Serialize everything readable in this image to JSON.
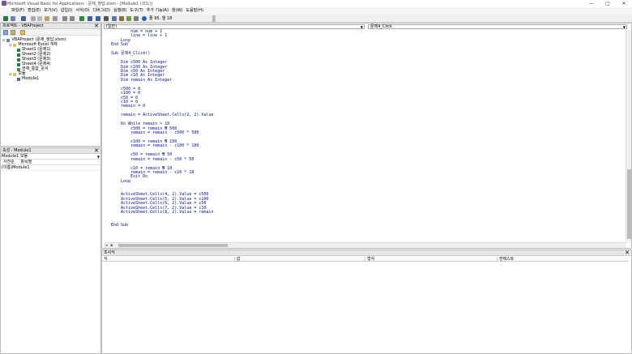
{
  "window": {
    "title": "Microsoft Visual Basic for Applications - 문제_정답.xlsm - [Module1 (코드)]",
    "min": "—",
    "max": "□",
    "close": "✕"
  },
  "menu": [
    "파일(F)",
    "편집(E)",
    "보기(V)",
    "삽입(I)",
    "서식(O)",
    "디버그(D)",
    "실행(R)",
    "도구(T)",
    "추가 기능(A)",
    "창(W)",
    "도움말(H)"
  ],
  "toolbar": {
    "position": "줄 95, 열 18",
    "icons": [
      "excel-icon",
      "insert-module-icon",
      "save-icon",
      "cut-icon",
      "copy-icon",
      "paste-icon",
      "find-icon",
      "undo-icon",
      "redo-icon",
      "run-icon",
      "break-icon",
      "reset-icon",
      "design-mode-icon",
      "project-explorer-icon",
      "properties-icon",
      "object-browser-icon",
      "toolbox-icon",
      "help-icon"
    ]
  },
  "project_panel": {
    "title": "프로젝트 - VBAProject",
    "tree": [
      {
        "label": "VBAProject (문제_정답.xlsm)",
        "level": 0,
        "icon": "project-icon"
      },
      {
        "label": "Microsoft Excel 개체",
        "level": 1,
        "icon": "folder-icon"
      },
      {
        "label": "Sheet1 (문제1)",
        "level": 2,
        "icon": "sheet-icon"
      },
      {
        "label": "Sheet2 (문제2)",
        "level": 2,
        "icon": "sheet-icon"
      },
      {
        "label": "Sheet3 (문제3)",
        "level": 2,
        "icon": "sheet-icon"
      },
      {
        "label": "Sheet4 (문제4)",
        "level": 2,
        "icon": "sheet-icon"
      },
      {
        "label": "현재_통합_문서",
        "level": 2,
        "icon": "workbook-icon"
      },
      {
        "label": "모듈",
        "level": 1,
        "icon": "folder-icon"
      },
      {
        "label": "Module1",
        "level": 2,
        "icon": "module-icon"
      }
    ]
  },
  "properties_panel": {
    "title": "속성 - Module1",
    "object": "Module1 모듈",
    "tabs": [
      "사전순",
      "항목별"
    ],
    "row": {
      "name": "(이름)",
      "value": "Module1"
    }
  },
  "code_window": {
    "object_combo": "(일반)",
    "proc_combo": "문제4_Click",
    "lines": [
      "        num = num + 1",
      "        line = line + 1",
      "    Loop",
      "End Sub",
      "",
      "Sub 문제4_Click()",
      "",
      "    Dim c500 As Integer",
      "    Dim c100 As Integer",
      "    Dim c50 As Integer",
      "    Dim c10 As Integer",
      "    Dim remain As Integer",
      "",
      "    c500 = 0",
      "    c100 = 0",
      "    c50 = 0",
      "    c10 = 0",
      "    remain = 0",
      "",
      "    remain = ActiveSheet.Cells(2, 2).Value",
      "",
      "    Do While remain > 10",
      "        c500 = remain ₩ 500",
      "        remain = remain - c500 * 500",
      "",
      "        c100 = remain ₩ 100",
      "        remain = remain - c100 * 100",
      "",
      "        c50 = remain ₩ 50",
      "        remain = remain - c50 * 50",
      "",
      "        c10 = remain ₩ 10",
      "        remain = remain - c10 * 10",
      "        Exit Do",
      "    Loop",
      "",
      "",
      "    ActiveSheet.Cells(4, 2).Value = c500",
      "    ActiveSheet.Cells(5, 2).Value = c100",
      "    ActiveSheet.Cells(6, 2).Value = c50",
      "    ActiveSheet.Cells(7, 2).Value = c10",
      "    ActiveSheet.Cells(8, 2).Value = remain",
      "",
      "",
      "End Sub"
    ]
  },
  "watch_window": {
    "title": "조사식",
    "columns": [
      "식",
      "값",
      "형식",
      "컨텍스트"
    ]
  },
  "colors": {
    "code_text": "#001090",
    "keyword": "#0000c0"
  }
}
